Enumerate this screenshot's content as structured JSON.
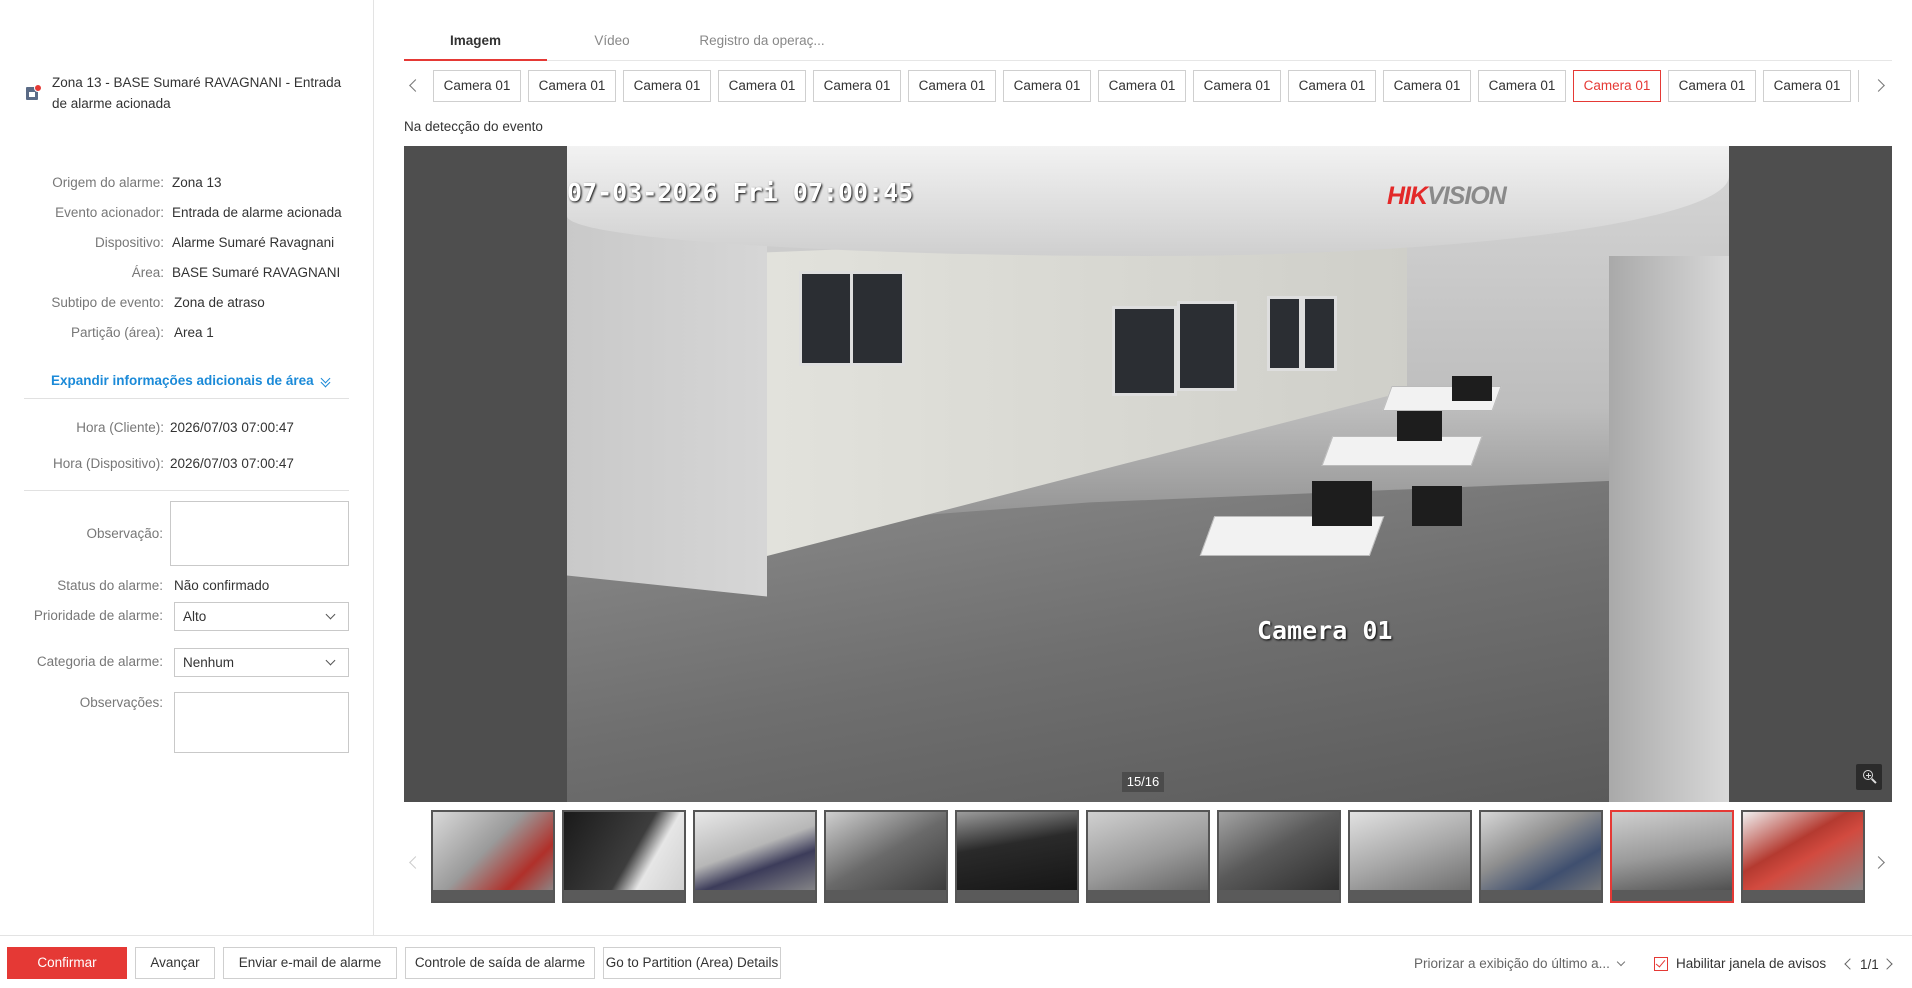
{
  "alarm": {
    "title": "Zona 13 - BASE Sumaré RAVAGNANI - Entrada de alarme acionada"
  },
  "details": [
    {
      "label": "Origem do alarme:",
      "value": "Zona 13"
    },
    {
      "label": "Evento acionador:",
      "value": "Entrada de alarme acionada"
    },
    {
      "label": "Dispositivo:",
      "value": "Alarme Sumaré Ravagnani"
    },
    {
      "label": "Área:",
      "value": "BASE Sumaré RAVAGNANI"
    },
    {
      "label": "Subtipo de evento:",
      "value": "Zona de atraso"
    },
    {
      "label": "Partição (área):",
      "value": "Area 1"
    }
  ],
  "expand_label": "Expandir informações adicionais de área",
  "times": [
    {
      "label": "Hora (Cliente):",
      "value": "2026/07/03 07:00:47"
    },
    {
      "label": "Hora (Dispositivo):",
      "value": "2026/07/03 07:00:47"
    }
  ],
  "form": {
    "observacao_label": "Observação:",
    "status_label": "Status do alarme:",
    "status_value": "Não confirmado",
    "priority_label": "Prioridade de alarme:",
    "priority_value": "Alto",
    "category_label": "Categoria de alarme:",
    "category_value": "Nenhum",
    "observacoes_label": "Observações:"
  },
  "tabs": [
    "Imagem",
    "Vídeo",
    "Registro da operaç..."
  ],
  "active_tab": 0,
  "cameras": [
    "Camera 01",
    "Camera 01",
    "Camera 01",
    "Camera 01",
    "Camera 01",
    "Camera 01",
    "Camera 01",
    "Camera 01",
    "Camera 01",
    "Camera 01",
    "Camera 01",
    "Camera 01",
    "Camera 01",
    "Camera 01",
    "Camera 01"
  ],
  "active_camera_index": 12,
  "event_caption": "Na detecção do evento",
  "viewer": {
    "osd_time": "07-03-2026 Fri 07:00:45",
    "osd_camera": "Camera 01",
    "brand_hik": "HIK",
    "brand_vision": "VISION",
    "page_counter": "15/16"
  },
  "thumbnails_active_index": 9,
  "footer": {
    "confirm": "Confirmar",
    "advance": "Avançar",
    "email": "Enviar e-mail de alarme",
    "output": "Controle de saída de alarme",
    "partition": "Go to Partition (Area) Details",
    "prioritize": "Priorizar a exibição do último a...",
    "enable_window": "Habilitar janela de avisos",
    "page": "1/1"
  },
  "colors": {
    "accent": "#e53935",
    "link": "#1b8ad8"
  }
}
